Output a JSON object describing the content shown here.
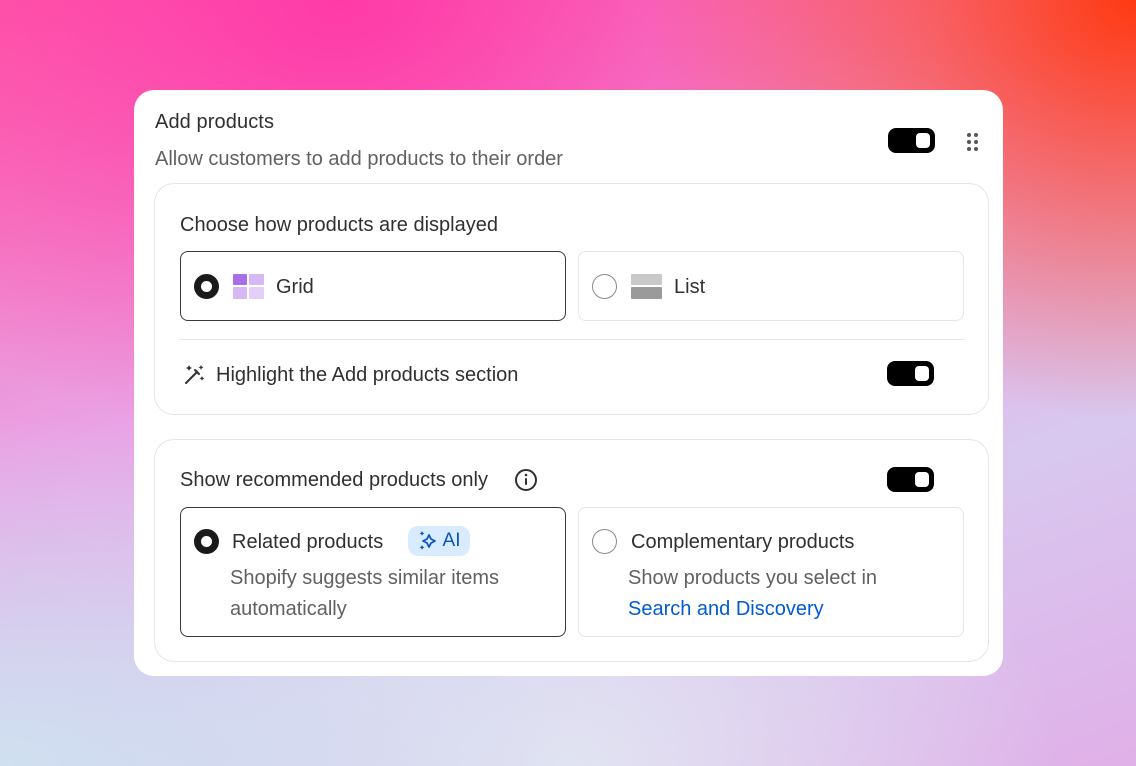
{
  "card": {
    "title": "Add products",
    "subtitle": "Allow customers to add products to their order",
    "enabled": true
  },
  "display_section": {
    "label": "Choose how products are displayed",
    "options": [
      {
        "label": "Grid",
        "icon": "grid-icon",
        "selected": true
      },
      {
        "label": "List",
        "icon": "list-icon",
        "selected": false
      }
    ],
    "highlight": {
      "label": "Highlight the Add products section",
      "icon": "magic-wand-icon",
      "enabled": true
    }
  },
  "recommended_section": {
    "label": "Show recommended products only",
    "info_icon": "info-icon",
    "enabled": true,
    "options": [
      {
        "title": "Related products",
        "badge": "AI",
        "desc_line1": "Shopify suggests similar items",
        "desc_line2": "automatically",
        "selected": true
      },
      {
        "title": "Complementary products",
        "desc_line1": "Show products you select in",
        "link": "Search and Discovery",
        "selected": false
      }
    ]
  },
  "colors": {
    "link": "#005bd3",
    "toggle_on": "#000000",
    "grid_icon": "#a86ee6",
    "ai_badge_bg": "#d8ebff"
  }
}
